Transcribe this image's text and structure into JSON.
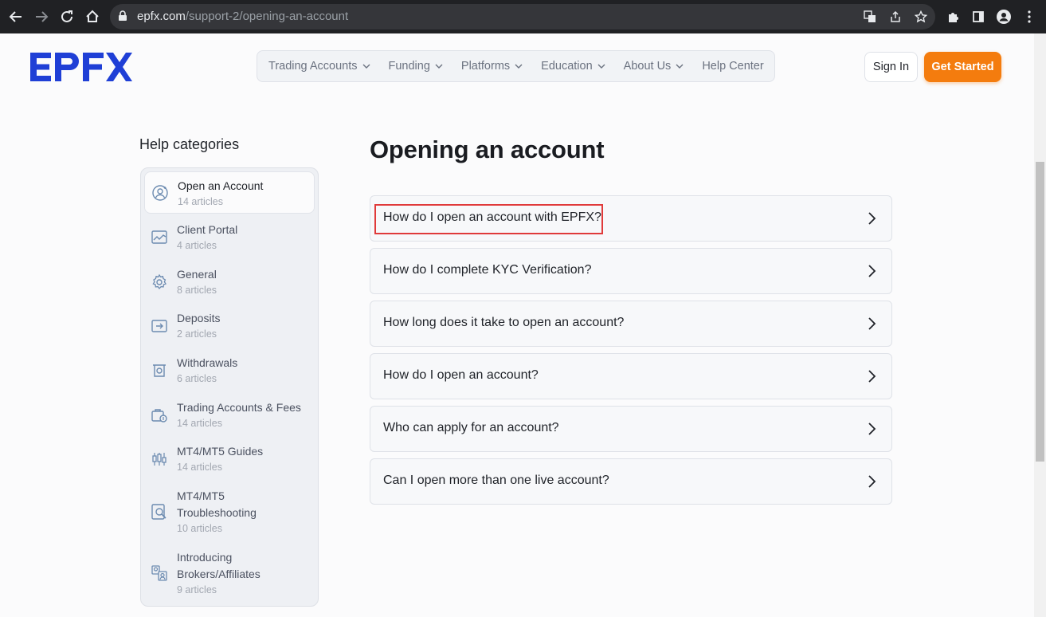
{
  "browser": {
    "url_domain": "epfx.com",
    "url_path": "/support-2/opening-an-account"
  },
  "brand": {
    "logo_text": "EPFX",
    "accent": "#f47c0e",
    "logo_color": "#1f3fd6"
  },
  "nav": {
    "items": [
      {
        "label": "Trading Accounts",
        "dropdown": true
      },
      {
        "label": "Funding",
        "dropdown": true
      },
      {
        "label": "Platforms",
        "dropdown": true
      },
      {
        "label": "Education",
        "dropdown": true
      },
      {
        "label": "About Us",
        "dropdown": true
      },
      {
        "label": "Help Center",
        "dropdown": false
      }
    ],
    "sign_in": "Sign In",
    "get_started": "Get Started"
  },
  "sidebar": {
    "heading": "Help categories",
    "categories": [
      {
        "name": "Open an Account",
        "count": "14 articles",
        "icon": "user-circle-icon",
        "active": true
      },
      {
        "name": "Client Portal",
        "count": "4 articles",
        "icon": "chart-window-icon"
      },
      {
        "name": "General",
        "count": "8 articles",
        "icon": "gear-icon"
      },
      {
        "name": "Deposits",
        "count": "2 articles",
        "icon": "wallet-in-icon"
      },
      {
        "name": "Withdrawals",
        "count": "6 articles",
        "icon": "withdraw-icon"
      },
      {
        "name": "Trading Accounts & Fees",
        "count": "14 articles",
        "icon": "briefcase-dollar-icon"
      },
      {
        "name": "MT4/MT5 Guides",
        "count": "14 articles",
        "icon": "candlestick-icon"
      },
      {
        "name": "MT4/MT5 Troubleshooting",
        "name_line1": "MT4/MT5",
        "name_line2": "Troubleshooting",
        "count": "10 articles",
        "icon": "magnify-document-icon"
      },
      {
        "name": "Introducing Brokers/Affiliates",
        "name_line1": "Introducing",
        "name_line2": "Brokers/Affiliates",
        "count": "9 articles",
        "icon": "affiliates-icon"
      }
    ]
  },
  "main": {
    "title": "Opening an account",
    "questions": [
      "How do I open an account with EPFX?",
      "How do I complete KYC Verification?",
      "How long does it take to open an account?",
      "How do I open an account?",
      "Who can apply for an account?",
      "Can I open more than one live account?"
    ]
  }
}
